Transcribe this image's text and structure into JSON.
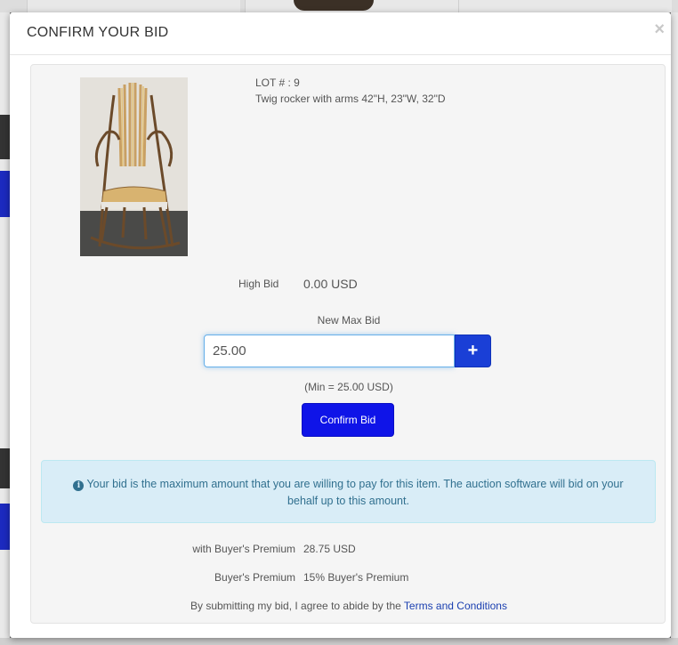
{
  "modal": {
    "title": "CONFIRM YOUR BID",
    "close_icon": "close-icon"
  },
  "lot": {
    "number_text": "LOT # : 9",
    "description": "Twig rocker with arms 42\"H, 23\"W, 32\"D",
    "image_alt": "Twig rocker chair photo"
  },
  "bid": {
    "high_bid_label": "High Bid",
    "high_bid_value": "0.00 USD",
    "new_max_label": "New Max Bid",
    "input_value": "25.00",
    "plus_label": "+",
    "min_note": "(Min = 25.00 USD)",
    "confirm_label": "Confirm Bid"
  },
  "info": {
    "icon": "info-icon",
    "text": "Your bid is the maximum amount that you are willing to pay for this item. The auction software will bid on your behalf up to this amount."
  },
  "premium": {
    "with_label": "with Buyer's Premium",
    "with_value": "28.75 USD",
    "label": "Buyer's Premium",
    "value": "15% Buyer's Premium"
  },
  "terms": {
    "prefix": "By submitting my bid, I agree to abide by the ",
    "link": "Terms and Conditions"
  },
  "colors": {
    "accent": "#0f14e8",
    "info_bg": "#d9edf7",
    "info_text": "#31708f",
    "link": "#1a3fb0"
  }
}
